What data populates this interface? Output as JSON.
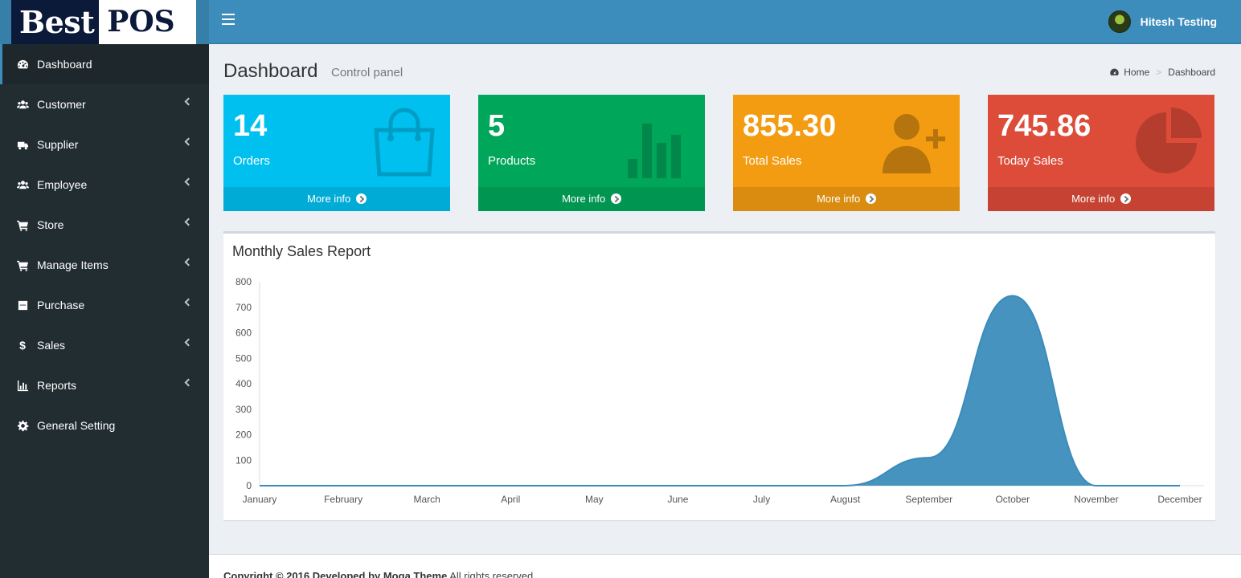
{
  "brand": {
    "part1": "Best",
    "part2": "POS"
  },
  "header": {
    "user_name": "Hitesh Testing"
  },
  "sidebar": {
    "items": [
      {
        "label": "Dashboard",
        "icon": "dashboard-icon",
        "active": true,
        "has_children": false
      },
      {
        "label": "Customer",
        "icon": "users-icon",
        "has_children": true
      },
      {
        "label": "Supplier",
        "icon": "truck-icon",
        "has_children": true
      },
      {
        "label": "Employee",
        "icon": "users-icon",
        "has_children": true
      },
      {
        "label": "Store",
        "icon": "cart-icon",
        "has_children": true
      },
      {
        "label": "Manage Items",
        "icon": "cart-icon",
        "has_children": true
      },
      {
        "label": "Purchase",
        "icon": "drawer-icon",
        "has_children": true
      },
      {
        "label": "Sales",
        "icon": "dollar-icon",
        "has_children": true
      },
      {
        "label": "Reports",
        "icon": "bar-chart-icon",
        "has_children": true
      },
      {
        "label": "General Setting",
        "icon": "gear-icon",
        "has_children": false
      }
    ]
  },
  "page": {
    "title": "Dashboard",
    "subtitle": "Control panel"
  },
  "breadcrumb": {
    "home": "Home",
    "current": "Dashboard"
  },
  "stat_boxes": [
    {
      "value": "14",
      "label": "Orders",
      "more": "More info",
      "color": "#00c0ef",
      "icon": "shopping-bag-icon"
    },
    {
      "value": "5",
      "label": "Products",
      "more": "More info",
      "color": "#00a65a",
      "icon": "bar-chart-icon"
    },
    {
      "value": "855.30",
      "label": "Total Sales",
      "more": "More info",
      "color": "#f39c12",
      "icon": "user-add-icon"
    },
    {
      "value": "745.86",
      "label": "Today Sales",
      "more": "More info",
      "color": "#dd4b39",
      "icon": "pie-chart-icon"
    }
  ],
  "chart_panel": {
    "title": "Monthly Sales Report"
  },
  "chart_data": {
    "type": "area",
    "categories": [
      "January",
      "February",
      "March",
      "April",
      "May",
      "June",
      "July",
      "August",
      "September",
      "October",
      "November",
      "December"
    ],
    "values": [
      0,
      0,
      0,
      0,
      0,
      0,
      0,
      0,
      110,
      745,
      0,
      0
    ],
    "ylim": [
      0,
      800
    ],
    "yticks": [
      0,
      100,
      200,
      300,
      400,
      500,
      600,
      700,
      800
    ],
    "color": "#3c8dbc",
    "grid": false
  },
  "footer": {
    "copyright": "Copyright © 2016 Developed by Moga Theme",
    "rights": "All rights reserved."
  },
  "colors": {
    "topbar": "#3c8dbc",
    "sidebar": "#222d32",
    "content_bg": "#ecf0f5"
  }
}
